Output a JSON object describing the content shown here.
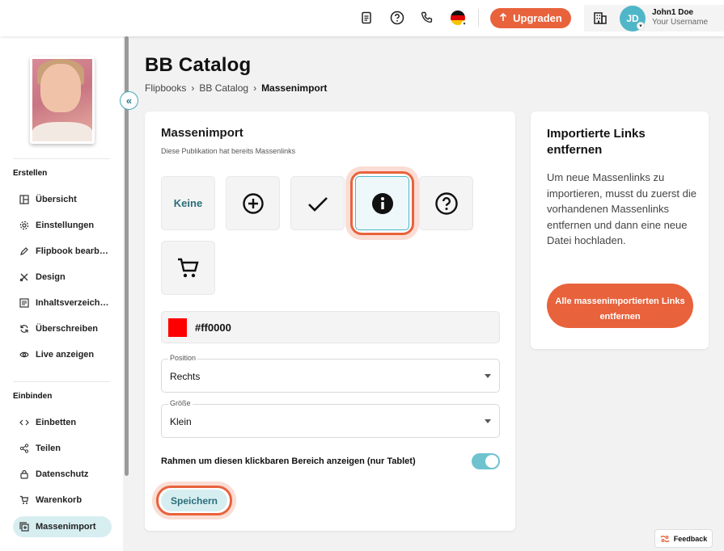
{
  "topbar": {
    "upgrade_label": "Upgraden",
    "user_initials": "JD",
    "user_name": "John1 Doe",
    "user_sub": "Your Username"
  },
  "sidebar": {
    "section_create": "Erstellen",
    "create_items": [
      {
        "label": "Übersicht",
        "icon": "layout-icon"
      },
      {
        "label": "Einstellungen",
        "icon": "gear-icon"
      },
      {
        "label": "Flipbook bearb…",
        "icon": "pencil-icon"
      },
      {
        "label": "Design",
        "icon": "design-tools-icon"
      },
      {
        "label": "Inhaltsverzeich…",
        "icon": "table-of-contents-icon"
      },
      {
        "label": "Überschreiben",
        "icon": "refresh-icon"
      },
      {
        "label": "Live anzeigen",
        "icon": "eye-icon"
      }
    ],
    "section_embed": "Einbinden",
    "embed_items": [
      {
        "label": "Einbetten",
        "icon": "code-icon"
      },
      {
        "label": "Teilen",
        "icon": "share-icon"
      },
      {
        "label": "Datenschutz",
        "icon": "lock-icon"
      },
      {
        "label": "Warenkorb",
        "icon": "cart-icon"
      },
      {
        "label": "Massenimport",
        "icon": "bulk-import-icon",
        "active": true
      }
    ]
  },
  "page": {
    "title": "BB Catalog",
    "breadcrumbs": [
      "Flipbooks",
      "BB Catalog",
      "Massenimport"
    ]
  },
  "main": {
    "title": "Massenimport",
    "subtitle": "Diese Publikation hat bereits Massenlinks",
    "icon_options": [
      {
        "name": "none",
        "label": "Keine"
      },
      {
        "name": "plus-circle-icon"
      },
      {
        "name": "check-icon"
      },
      {
        "name": "info-icon",
        "selected": true
      },
      {
        "name": "question-circle-icon"
      },
      {
        "name": "cart-icon"
      }
    ],
    "color_hex": "#ff0000",
    "position_label": "Position",
    "position_value": "Rechts",
    "size_label": "Größe",
    "size_value": "Klein",
    "frame_toggle_label": "Rahmen um diesen klickbaren Bereich anzeigen (nur Tablet)",
    "frame_toggle_on": true,
    "save_label": "Speichern"
  },
  "side": {
    "title": "Importierte Links entfernen",
    "text": "Um neue Massenlinks zu importieren, musst du zuerst die vorhandenen Massenlinks entfernen und dann eine neue Datei hochladen.",
    "button_label": "Alle massenimportierten Links entfernen"
  },
  "feedback_label": "Feedback",
  "colors": {
    "accent": "#e8623c",
    "teal": "#4fb6c8",
    "active_nav": "#d7eef1"
  }
}
